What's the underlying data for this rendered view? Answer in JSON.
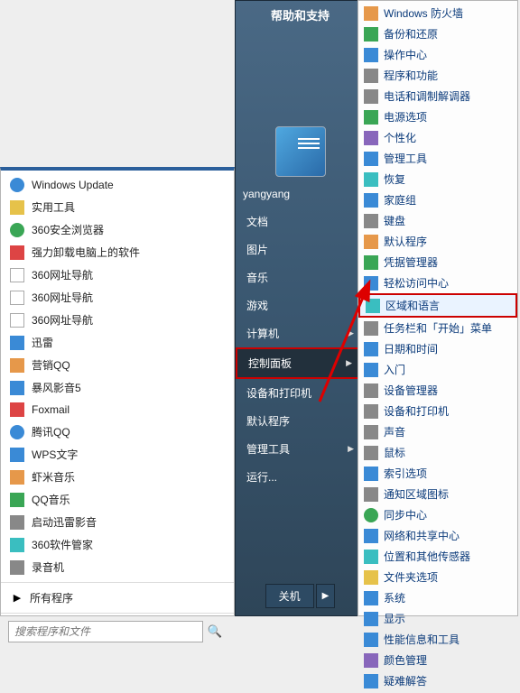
{
  "left_panel": {
    "items": [
      {
        "label": "Windows Update",
        "icon": "windows-update-icon",
        "cls": "c-blue round"
      },
      {
        "label": "实用工具",
        "icon": "folder-icon",
        "cls": "c-yellow"
      },
      {
        "label": "360安全浏览器",
        "icon": "360browser-icon",
        "cls": "c-green round"
      },
      {
        "label": "强力卸载电脑上的软件",
        "icon": "uninstall-icon",
        "cls": "c-red"
      },
      {
        "label": "360网址导航",
        "icon": "nav-icon",
        "cls": "c-white"
      },
      {
        "label": "360网址导航",
        "icon": "nav-icon",
        "cls": "c-white"
      },
      {
        "label": "360网址导航",
        "icon": "nav-icon",
        "cls": "c-white"
      },
      {
        "label": "迅雷",
        "icon": "xunlei-icon",
        "cls": "c-blue"
      },
      {
        "label": "营销QQ",
        "icon": "qq-marketing-icon",
        "cls": "c-orange"
      },
      {
        "label": "暴风影音5",
        "icon": "baofeng-icon",
        "cls": "c-blue"
      },
      {
        "label": "Foxmail",
        "icon": "foxmail-icon",
        "cls": "c-red"
      },
      {
        "label": "腾讯QQ",
        "icon": "qq-icon",
        "cls": "c-blue round"
      },
      {
        "label": "WPS文字",
        "icon": "wps-icon",
        "cls": "c-blue"
      },
      {
        "label": "虾米音乐",
        "icon": "xiami-icon",
        "cls": "c-orange"
      },
      {
        "label": "QQ音乐",
        "icon": "qqmusic-icon",
        "cls": "c-green"
      },
      {
        "label": "启动迅雷影音",
        "icon": "xunlei-media-icon",
        "cls": "c-grey"
      },
      {
        "label": "360软件管家",
        "icon": "360soft-icon",
        "cls": "c-cyan"
      },
      {
        "label": "录音机",
        "icon": "recorder-icon",
        "cls": "c-grey"
      }
    ],
    "all_programs": "所有程序",
    "search_placeholder": "搜索程序和文件"
  },
  "mid_panel": {
    "help_title": "帮助和支持",
    "username": "yangyang",
    "items": [
      {
        "label": "文档",
        "arrow": false
      },
      {
        "label": "图片",
        "arrow": false
      },
      {
        "label": "音乐",
        "arrow": false
      },
      {
        "label": "游戏",
        "arrow": false
      },
      {
        "label": "计算机",
        "arrow": true
      },
      {
        "label": "控制面板",
        "arrow": true,
        "active": true
      },
      {
        "label": "设备和打印机",
        "arrow": false
      },
      {
        "label": "默认程序",
        "arrow": false
      },
      {
        "label": "管理工具",
        "arrow": true
      },
      {
        "label": "运行...",
        "arrow": false
      }
    ],
    "shutdown": "关机"
  },
  "right_panel": {
    "items": [
      {
        "label": "Windows 防火墙",
        "icon": "firewall-icon",
        "cls": "c-orange"
      },
      {
        "label": "备份和还原",
        "icon": "backup-icon",
        "cls": "c-green"
      },
      {
        "label": "操作中心",
        "icon": "action-center-icon",
        "cls": "c-blue"
      },
      {
        "label": "程序和功能",
        "icon": "programs-icon",
        "cls": "c-grey"
      },
      {
        "label": "电话和调制解调器",
        "icon": "modem-icon",
        "cls": "c-grey"
      },
      {
        "label": "电源选项",
        "icon": "power-icon",
        "cls": "c-green"
      },
      {
        "label": "个性化",
        "icon": "personalize-icon",
        "cls": "c-purple"
      },
      {
        "label": "管理工具",
        "icon": "admin-tools-icon",
        "cls": "c-blue"
      },
      {
        "label": "恢复",
        "icon": "recovery-icon",
        "cls": "c-cyan"
      },
      {
        "label": "家庭组",
        "icon": "homegroup-icon",
        "cls": "c-blue"
      },
      {
        "label": "键盘",
        "icon": "keyboard-icon",
        "cls": "c-grey"
      },
      {
        "label": "默认程序",
        "icon": "default-programs-icon",
        "cls": "c-orange"
      },
      {
        "label": "凭据管理器",
        "icon": "credentials-icon",
        "cls": "c-green"
      },
      {
        "label": "轻松访问中心",
        "icon": "ease-access-icon",
        "cls": "c-blue"
      },
      {
        "label": "区域和语言",
        "icon": "region-language-icon",
        "cls": "c-cyan",
        "highlight": true
      },
      {
        "label": "任务栏和「开始」菜单",
        "icon": "taskbar-icon",
        "cls": "c-grey"
      },
      {
        "label": "日期和时间",
        "icon": "datetime-icon",
        "cls": "c-blue"
      },
      {
        "label": "入门",
        "icon": "getting-started-icon",
        "cls": "c-blue"
      },
      {
        "label": "设备管理器",
        "icon": "device-manager-icon",
        "cls": "c-grey"
      },
      {
        "label": "设备和打印机",
        "icon": "printers-icon",
        "cls": "c-grey"
      },
      {
        "label": "声音",
        "icon": "sound-icon",
        "cls": "c-grey"
      },
      {
        "label": "鼠标",
        "icon": "mouse-icon",
        "cls": "c-grey"
      },
      {
        "label": "索引选项",
        "icon": "indexing-icon",
        "cls": "c-blue"
      },
      {
        "label": "通知区域图标",
        "icon": "notification-icon",
        "cls": "c-grey"
      },
      {
        "label": "同步中心",
        "icon": "sync-icon",
        "cls": "c-green round"
      },
      {
        "label": "网络和共享中心",
        "icon": "network-icon",
        "cls": "c-blue"
      },
      {
        "label": "位置和其他传感器",
        "icon": "location-icon",
        "cls": "c-cyan"
      },
      {
        "label": "文件夹选项",
        "icon": "folder-options-icon",
        "cls": "c-yellow"
      },
      {
        "label": "系统",
        "icon": "system-icon",
        "cls": "c-blue"
      },
      {
        "label": "显示",
        "icon": "display-icon",
        "cls": "c-blue"
      },
      {
        "label": "性能信息和工具",
        "icon": "performance-icon",
        "cls": "c-blue"
      },
      {
        "label": "颜色管理",
        "icon": "color-mgmt-icon",
        "cls": "c-purple"
      },
      {
        "label": "疑难解答",
        "icon": "troubleshoot-icon",
        "cls": "c-blue"
      }
    ]
  }
}
